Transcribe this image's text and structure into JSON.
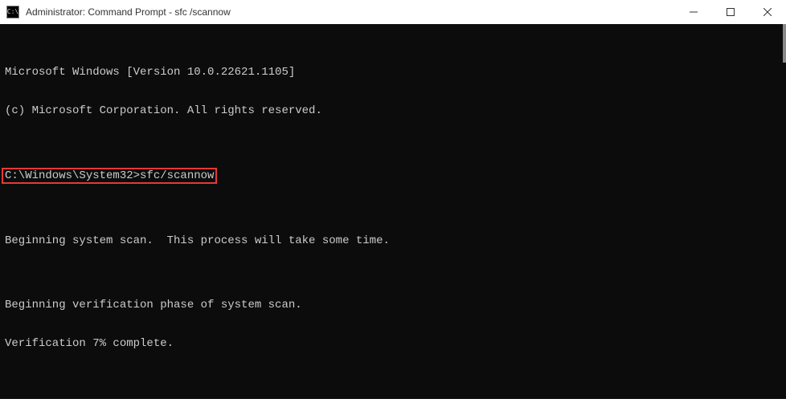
{
  "window": {
    "title": "Administrator: Command Prompt - sfc /scannow",
    "icon_text": "C:\\"
  },
  "terminal": {
    "line1": "Microsoft Windows [Version 10.0.22621.1105]",
    "line2": "(c) Microsoft Corporation. All rights reserved.",
    "blank1": "",
    "prompt_line": "C:\\Windows\\System32>sfc/scannow",
    "blank2": "",
    "line3": "Beginning system scan.  This process will take some time.",
    "blank3": "",
    "line4": "Beginning verification phase of system scan.",
    "line5": "Verification 7% complete."
  },
  "highlight": {
    "color": "#e53935"
  }
}
